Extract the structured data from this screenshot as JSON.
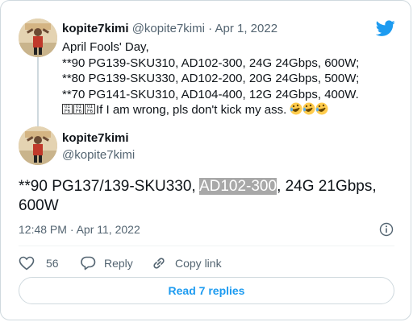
{
  "quoted_tweet": {
    "display_name": "kopite7kimi",
    "handle": "@kopite7kimi",
    "separator": " · ",
    "date": "Apr 1, 2022",
    "lines": [
      "April Fools' Day,",
      "**90 PG139-SKU310, AD102-300, 24G 24Gbps, 600W;",
      "**80 PG139-SKU330, AD102-200, 20G 24Gbps, 500W;",
      "**70 PG141-SKU310, AD104-400, 12G 24Gbps, 400W."
    ],
    "last_line_text": "If I am wrong, pls don't kick my ass.",
    "emoji_names": [
      "rolling-on-floor-laughing",
      "rolling-on-floor-laughing",
      "rolling-on-floor-laughing"
    ]
  },
  "main_tweet": {
    "display_name": "kopite7kimi",
    "handle": "@kopite7kimi",
    "text_before": "**90 PG137/139-SKU330, ",
    "text_highlight": "AD102-300",
    "text_after": ", 24G 21Gbps, 600W",
    "timestamp": "12:48 PM · Apr 11, 2022"
  },
  "actions": {
    "like_count": "56",
    "reply_label": "Reply",
    "copy_link_label": "Copy link"
  },
  "read_replies_label": "Read 7 replies",
  "icons": [
    "twitter-bird-icon",
    "info-icon",
    "heart-icon",
    "reply-icon",
    "link-icon"
  ],
  "colors": {
    "accent": "#1d9bf0",
    "muted": "#536471",
    "border": "#cfd9de",
    "highlight": "#a8a8a8"
  }
}
